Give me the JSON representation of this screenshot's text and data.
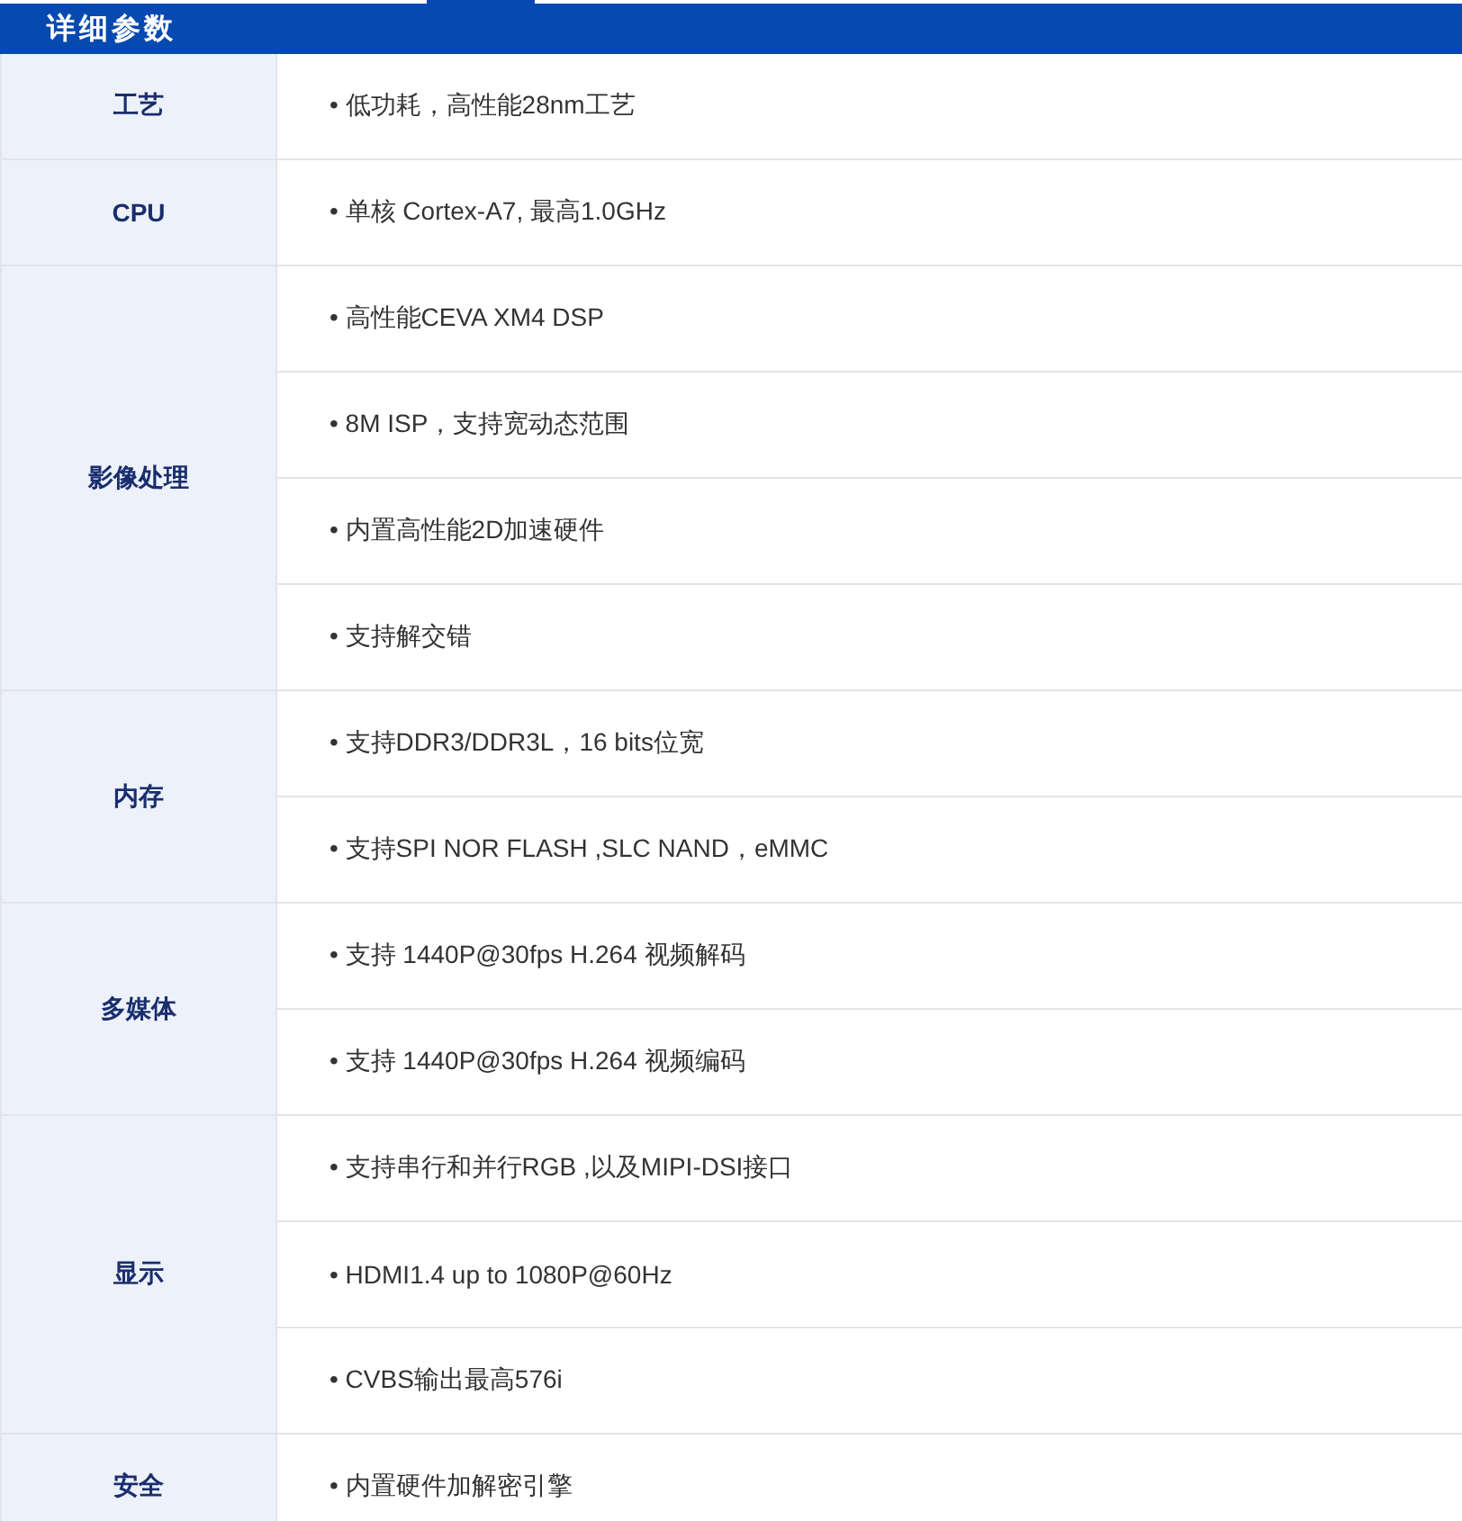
{
  "title": "详细参数",
  "groups": [
    {
      "label": "工艺",
      "items": [
        "• 低功耗，高性能28nm工艺"
      ]
    },
    {
      "label": "CPU",
      "items": [
        "• 单核 Cortex-A7, 最高1.0GHz"
      ]
    },
    {
      "label": "影像处理",
      "items": [
        "• 高性能CEVA XM4 DSP",
        "• 8M ISP，支持宽动态范围",
        "• 内置高性能2D加速硬件",
        "• 支持解交错"
      ]
    },
    {
      "label": "内存",
      "items": [
        "• 支持DDR3/DDR3L，16 bits位宽",
        "• 支持SPI NOR FLASH ,SLC NAND，eMMC"
      ]
    },
    {
      "label": "多媒体",
      "items": [
        "• 支持 1440P@30fps H.264 视频解码",
        "• 支持 1440P@30fps H.264 视频编码"
      ]
    },
    {
      "label": "显示",
      "items": [
        "• 支持串行和并行RGB ,以及MIPI-DSI接口",
        "• HDMI1.4 up to 1080P@60Hz",
        "• CVBS输出最高576i"
      ]
    },
    {
      "label": "安全",
      "items": [
        "• 内置硬件加解密引擎"
      ]
    }
  ]
}
